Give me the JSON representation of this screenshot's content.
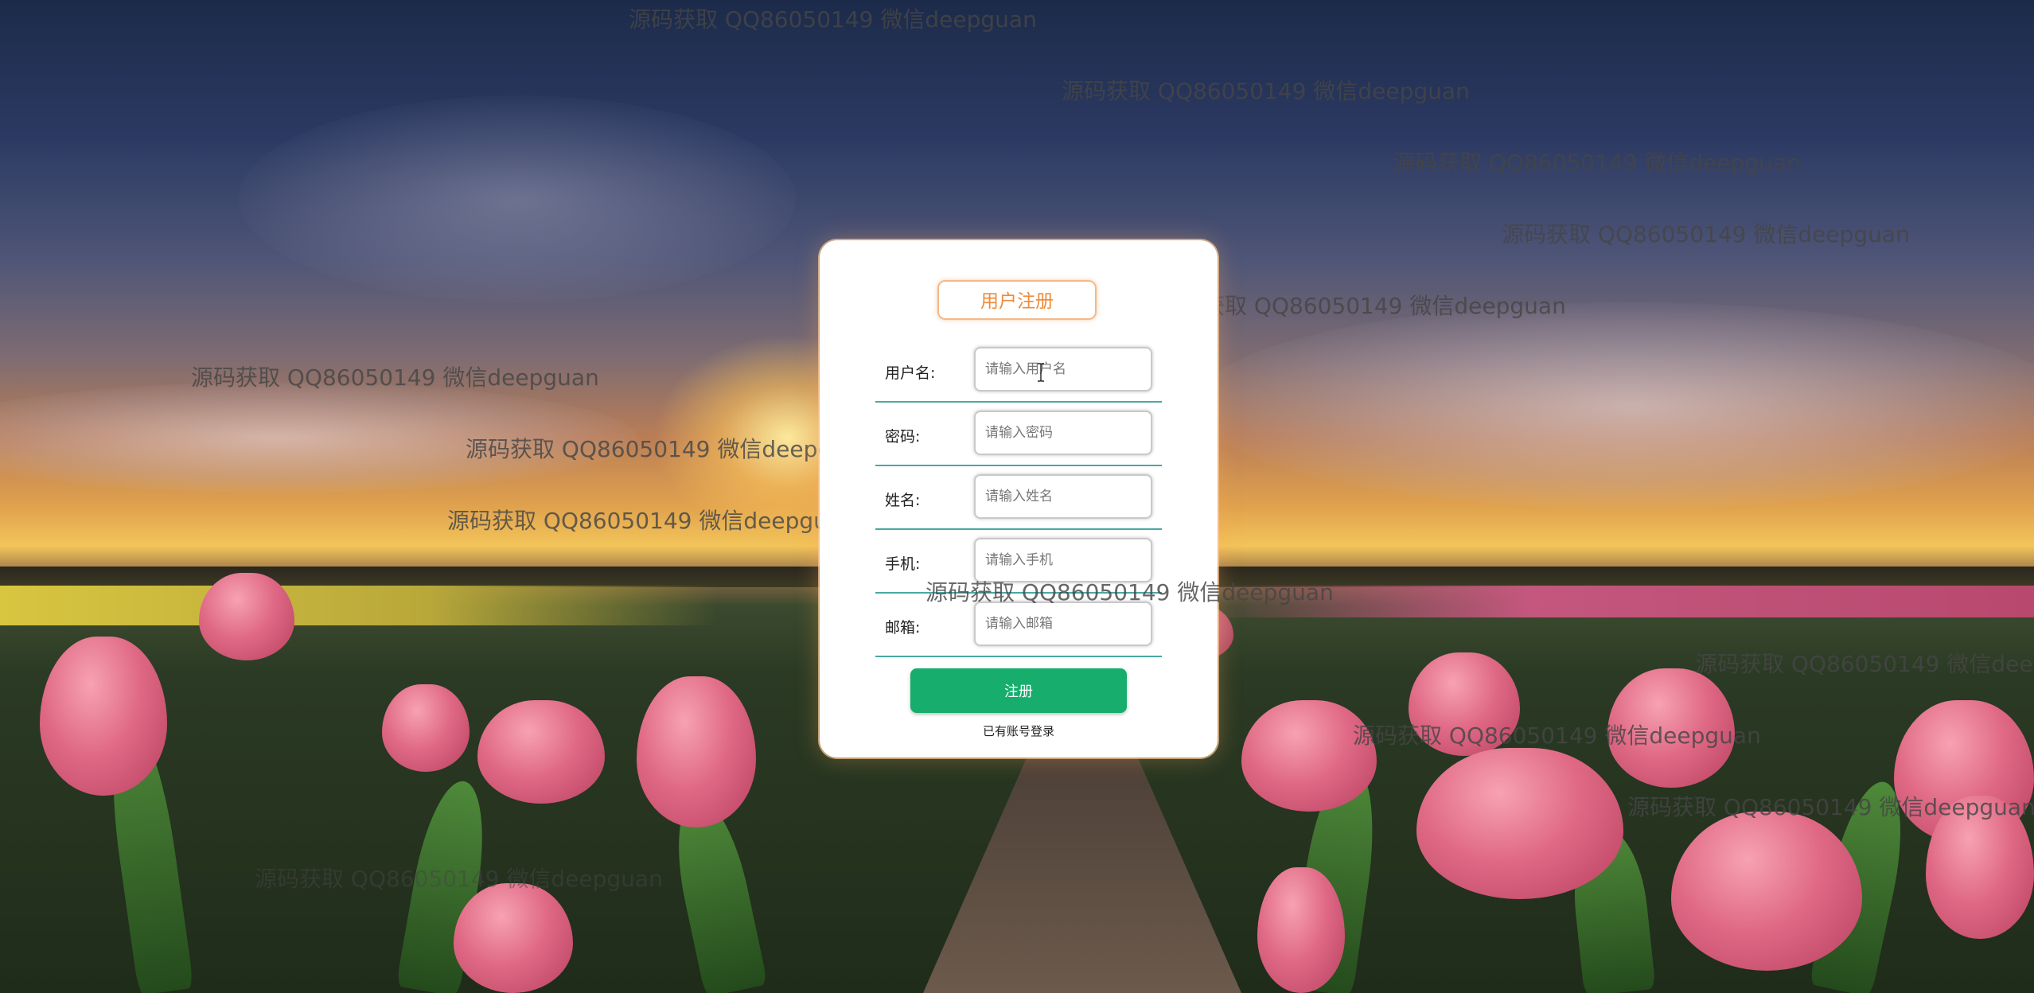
{
  "form": {
    "title": "用户注册",
    "fields": [
      {
        "label": "用户名:",
        "placeholder": "请输入用户名",
        "value": ""
      },
      {
        "label": "密码:",
        "placeholder": "请输入密码",
        "value": ""
      },
      {
        "label": "姓名:",
        "placeholder": "请输入姓名",
        "value": ""
      },
      {
        "label": "手机:",
        "placeholder": "请输入手机",
        "value": ""
      },
      {
        "label": "邮箱:",
        "placeholder": "请输入邮箱",
        "value": ""
      }
    ],
    "submit_label": "注册",
    "login_link_label": "已有账号登录"
  },
  "watermark": {
    "text": "源码获取 QQ86050149 微信deepguan"
  },
  "colors": {
    "title_text": "#f08a38",
    "title_border": "#f4b98a",
    "submit_bg": "#16ad6d",
    "row_divider": "#4aa9a2"
  },
  "icons": {
    "text_cursor": "i-beam-cursor-icon"
  }
}
